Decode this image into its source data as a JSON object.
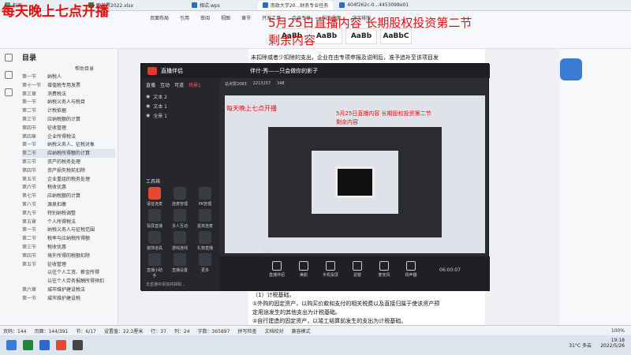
{
  "tabs": [
    {
      "label": "稻壳",
      "active": false
    },
    {
      "label": "欧美票2022.xlsx",
      "active": false
    },
    {
      "label": "相式.wps",
      "active": false
    },
    {
      "label": "南政大学20...财务专业任务",
      "active": true
    },
    {
      "label": "404f262c-0...4453098e01",
      "active": false
    }
  ],
  "ribbon": {
    "menu": [
      "页面布局",
      "引用",
      "审阅",
      "视图",
      "章节",
      "开发工具",
      "会员专享",
      "稻壳资源",
      "文字排版"
    ],
    "styles": [
      "AaBb",
      "AaBb",
      "AaBb",
      "AaBbC"
    ]
  },
  "sidebar": {
    "title": "目录",
    "extra_button": "帮助目录",
    "items": [
      {
        "ch": "第一节",
        "text": "纳税人"
      },
      {
        "ch": "第十一节",
        "text": "增值税专用发票"
      },
      {
        "ch": "第三章",
        "text": "消费税法"
      },
      {
        "ch": "第一节",
        "text": "纳税义务人与税目"
      },
      {
        "ch": "第二节",
        "text": "计税依据"
      },
      {
        "ch": "第三节",
        "text": "应纳税额的计算"
      },
      {
        "ch": "第四节",
        "text": "征收管理"
      },
      {
        "ch": "第四章",
        "text": "企业所得税法"
      },
      {
        "ch": "第一节",
        "text": "纳税义务人、征税对象"
      },
      {
        "ch": "第二节",
        "text": "应纳税所得额的计算",
        "active": true
      },
      {
        "ch": "第三节",
        "text": "资产的税务处理"
      },
      {
        "ch": "第四节",
        "text": "资产损失税前扣除"
      },
      {
        "ch": "第五节",
        "text": "企业重组的税务处理"
      },
      {
        "ch": "第六节",
        "text": "税收优惠"
      },
      {
        "ch": "第七节",
        "text": "应纳税额的计算"
      },
      {
        "ch": "第八节",
        "text": "源泉扣缴"
      },
      {
        "ch": "第九节",
        "text": "特别纳税调整"
      },
      {
        "ch": "第五章",
        "text": "个人所得税法"
      },
      {
        "ch": "第一节",
        "text": "纳税义务人与征税范围"
      },
      {
        "ch": "第二节",
        "text": "税率与应纳税所得额"
      },
      {
        "ch": "第三节",
        "text": "税收优惠"
      },
      {
        "ch": "第四节",
        "text": "境外所得的税额扣除"
      },
      {
        "ch": "第五节",
        "text": "征收管理"
      },
      {
        "ch": "",
        "text": "以往个人工资、薪金所得"
      },
      {
        "ch": "",
        "text": "以往个人劳务报酬所得预扣"
      },
      {
        "ch": "第六章",
        "text": "城市维护建设税法"
      },
      {
        "ch": "第一节",
        "text": "城市维护建设税"
      }
    ]
  },
  "doc": {
    "line_top": "未扣除或者少扣除的支出，企业在由专项申报及说明后，准予追补至该项目发",
    "lines_bottom": [
      "（1）计税基础。",
      "①外购的固定资产，以购买价款和支付的相关税费以及直接归属于使该资产预",
      "定用途发生的其他支出为计税基础。",
      "②自行建造的固定资产，以竣工结算前发生的支出为计税基础。"
    ]
  },
  "live": {
    "app_name": "直播伴侣",
    "tabs": [
      "直播",
      "互动",
      "可道",
      "场景1"
    ],
    "scenes": [
      "文本 2",
      "文本 1",
      "全景 1"
    ],
    "window_title": "伴什·秀——只会做你的影子",
    "stats": [
      "总点赞2083",
      "2213257",
      "348"
    ],
    "toolbox_label": "工具箱",
    "tools": [
      "语音连麦",
      "连麦管理",
      "PK管理",
      "投屏直播",
      "多人互动",
      "嘉宾连麦",
      "装饰道具",
      "游戏连线",
      "礼物直播",
      "直播小助手",
      "直播设置",
      "更多"
    ],
    "bottom": [
      "直播伴侣",
      "美颜",
      "手机投屏",
      "滤镜",
      "麦克风",
      "扬声器"
    ],
    "timer": "06:00:07",
    "footer_note": "去直播中添加并获取...",
    "volume_label": "100"
  },
  "overlay": {
    "left": "每天晚上七点开播",
    "right_line1": "5月25日直播内容 长期股权投资第二节",
    "right_line2": "剩余内容",
    "inner_left": "每天晚上七点开播",
    "inner_right1": "5月25日直播内容 长期股权投资第二节",
    "inner_right2": "剩余内容"
  },
  "status": {
    "items": [
      "页码：144",
      "页面：144/391",
      "节：6/17",
      "设置值：22.3厘米",
      "行：37",
      "列：24",
      "字数：365897",
      "拼写检查",
      "文档校对",
      "兼容模式"
    ],
    "zoom": "100%"
  },
  "taskbar": {
    "time": "19:18",
    "date": "2022/5/26",
    "weather": "31°C 多云"
  },
  "colors": {
    "overlay_red": "#e01010",
    "live_bg": "#2b2d33",
    "accent_orange": "#e8482f"
  }
}
